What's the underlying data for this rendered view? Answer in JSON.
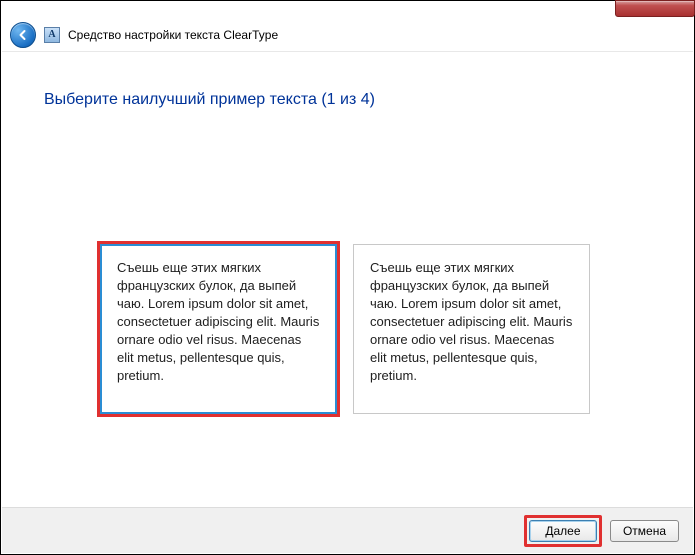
{
  "header": {
    "app_icon_letter": "A",
    "title": "Средство настройки текста ClearType"
  },
  "content": {
    "heading": "Выберите наилучший пример текста (1 из 4)",
    "samples": [
      {
        "text": "Съешь еще этих мягких французских булок, да выпей чаю. Lorem ipsum dolor sit amet, consectetuer adipiscing elit. Mauris ornare odio vel risus. Maecenas elit metus, pellentesque quis, pretium.",
        "selected": true,
        "highlighted": true
      },
      {
        "text": "Съешь еще этих мягких французских булок, да выпей чаю. Lorem ipsum dolor sit amet, consectetuer adipiscing elit. Mauris ornare odio vel risus. Maecenas elit metus, pellentesque quis, pretium.",
        "selected": false,
        "highlighted": false
      }
    ]
  },
  "footer": {
    "next_label": "Далее",
    "cancel_label": "Отмена"
  }
}
